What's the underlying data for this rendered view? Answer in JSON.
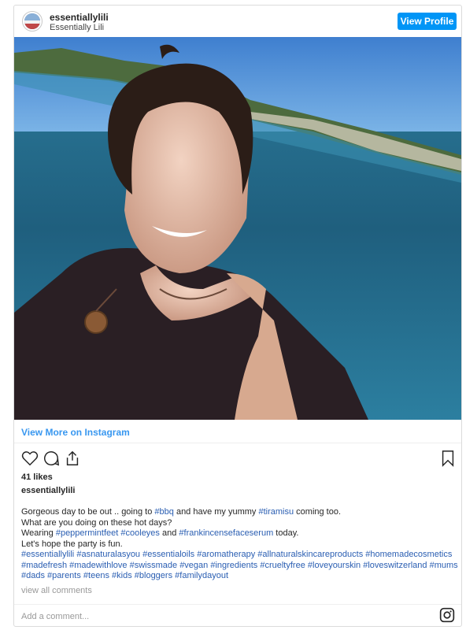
{
  "header": {
    "username": "essentiallylili",
    "display_name": "Essentially Lili",
    "view_profile_label": "View Profile"
  },
  "post": {
    "view_more_label": "View More on Instagram",
    "likes": "41 likes",
    "owner": "essentiallylili",
    "caption_lines": [
      [
        {
          "t": "Gorgeous day to be out .. going to "
        },
        {
          "t": "#bbq",
          "tag": true
        },
        {
          "t": " and have my yummy "
        },
        {
          "t": "#tiramisu",
          "tag": true
        },
        {
          "t": " coming too."
        }
      ],
      [
        {
          "t": "What are you doing on these hot days?"
        }
      ],
      [
        {
          "t": "Wearing "
        },
        {
          "t": "#peppermintfeet",
          "tag": true
        },
        {
          "t": " "
        },
        {
          "t": "#cooleyes",
          "tag": true
        },
        {
          "t": " and "
        },
        {
          "t": "#frankincensefaceserum",
          "tag": true
        },
        {
          "t": " today."
        }
      ],
      [
        {
          "t": "Let's hope the party is fun."
        }
      ],
      [
        {
          "t": "#essentiallylili",
          "tag": true
        },
        {
          "t": " "
        },
        {
          "t": "#asnaturalasyou",
          "tag": true
        },
        {
          "t": " "
        },
        {
          "t": "#essentialoils",
          "tag": true
        },
        {
          "t": " "
        },
        {
          "t": "#aromatherapy",
          "tag": true
        },
        {
          "t": " "
        },
        {
          "t": "#allnaturalskincareproducts",
          "tag": true
        },
        {
          "t": " "
        },
        {
          "t": "#homemadecosmetics",
          "tag": true
        }
      ],
      [
        {
          "t": "#madefresh",
          "tag": true
        },
        {
          "t": " "
        },
        {
          "t": "#madewithlove",
          "tag": true
        },
        {
          "t": " "
        },
        {
          "t": "#swissmade",
          "tag": true
        },
        {
          "t": " "
        },
        {
          "t": "#vegan",
          "tag": true
        },
        {
          "t": " "
        },
        {
          "t": "#ingredients",
          "tag": true
        },
        {
          "t": " "
        },
        {
          "t": "#crueltyfree",
          "tag": true
        },
        {
          "t": " "
        },
        {
          "t": "#loveyourskin",
          "tag": true
        },
        {
          "t": " "
        },
        {
          "t": "#loveswitzerland",
          "tag": true
        },
        {
          "t": " "
        },
        {
          "t": "#mums",
          "tag": true
        }
      ],
      [
        {
          "t": "#dads",
          "tag": true
        },
        {
          "t": " "
        },
        {
          "t": "#parents",
          "tag": true
        },
        {
          "t": " "
        },
        {
          "t": "#teens",
          "tag": true
        },
        {
          "t": " "
        },
        {
          "t": "#kids",
          "tag": true
        },
        {
          "t": " "
        },
        {
          "t": "#bloggers",
          "tag": true
        },
        {
          "t": " "
        },
        {
          "t": "#familydayout",
          "tag": true
        }
      ]
    ],
    "view_comments_label": "view all comments",
    "comment_placeholder": "Add a comment..."
  },
  "icons": {
    "like": "heart-icon",
    "comment": "comment-icon",
    "share": "share-icon",
    "save": "bookmark-icon",
    "brand": "instagram-icon"
  },
  "colors": {
    "accent": "#0095f6",
    "link": "#3897f0",
    "hashtag": "#2a5eb2"
  }
}
